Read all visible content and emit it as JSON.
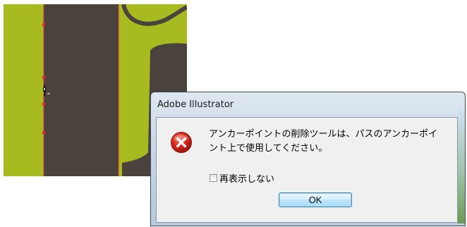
{
  "dialog": {
    "title": "Adobe Illustrator",
    "message_line1": "アンカーポイントの削除ツールは、パスのアンカーポイ",
    "message_line2": "ント上で使用してください。",
    "checkbox_label": "再表示しない",
    "checkbox_checked": false,
    "ok_label": "OK",
    "icon": "error-icon"
  },
  "artwork": {
    "background_color": "#a7bb21",
    "shape_color": "#4a423d",
    "path_color": "#e8283a"
  },
  "cursor": {
    "icon": "delete-anchor-point-cursor-icon"
  }
}
